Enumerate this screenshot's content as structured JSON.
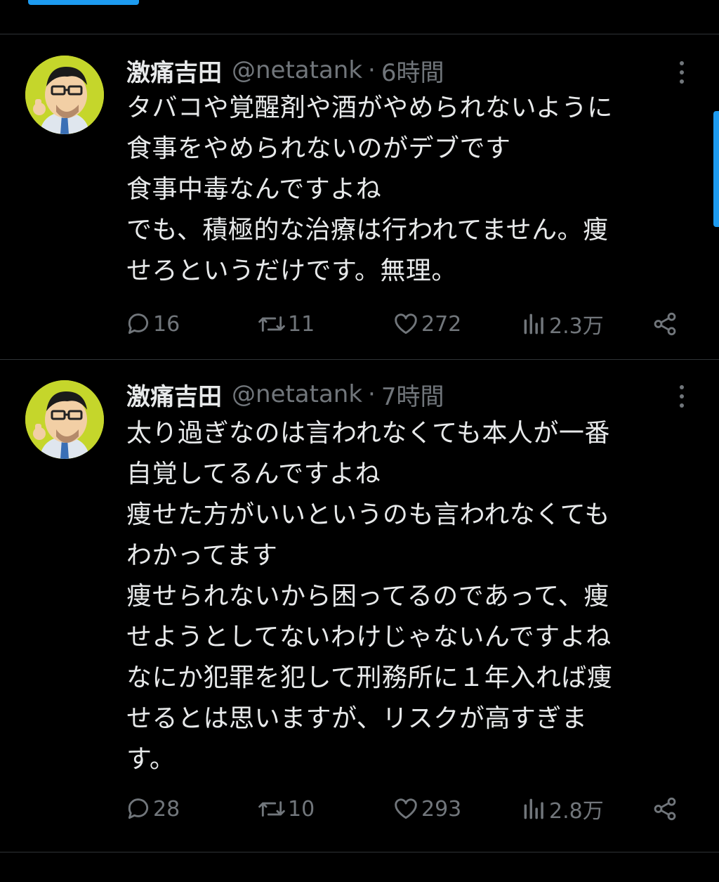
{
  "colors": {
    "background": "#000000",
    "text": "#e7e9ea",
    "secondary": "#71767b",
    "accent": "#1d9bf0",
    "divider": "#2f3336"
  },
  "tweets": [
    {
      "name": "激痛吉田",
      "handle": "@netatank",
      "separator": "·",
      "time": "6時間",
      "lines": [
        "タバコや覚醒剤や酒がやめられないように",
        "食事をやめられないのがデブです",
        "食事中毒なんですよね",
        "でも、積極的な治療は行われてません。痩",
        "せろというだけです。無理。"
      ],
      "replies": "16",
      "retweets": "11",
      "likes": "272",
      "views": "2.3万"
    },
    {
      "name": "激痛吉田",
      "handle": "@netatank",
      "separator": "·",
      "time": "7時間",
      "lines": [
        "太り過ぎなのは言われなくても本人が一番",
        "自覚してるんですよね",
        "痩せた方がいいというのも言われなくても",
        "わかってます",
        "痩せられないから困ってるのであって、痩",
        "せようとしてないわけじゃないんですよね",
        "なにか犯罪を犯して刑務所に１年入れば痩",
        "せるとは思いますが、リスクが高すぎま",
        "す。"
      ],
      "replies": "28",
      "retweets": "10",
      "likes": "293",
      "views": "2.8万"
    }
  ]
}
